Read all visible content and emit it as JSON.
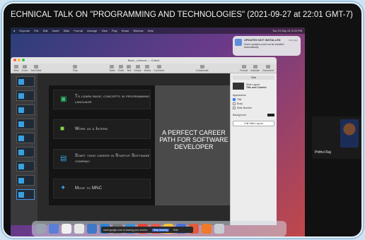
{
  "meeting": {
    "title": "ECHNICAL TALK ON \"PROGRAMMING AND TECHNOLOGIES\" (2021-09-27 at 22:01 GMT-7)"
  },
  "menubar": {
    "items": [
      "Keynote",
      "File",
      "Edit",
      "Insert",
      "Slide",
      "Format",
      "Arrange",
      "View",
      "Play",
      "Share",
      "Window",
      "Help"
    ],
    "right": [
      "Tue 21 Sep 21 9:22 PM"
    ]
  },
  "notification": {
    "title": "UPDATES NOT INSTALLED",
    "time": "now ago",
    "body": "Some updates could not be installed automatically."
  },
  "keynote": {
    "window_title": "Basic_Letdown — Edited",
    "toolbar": [
      "View",
      "Zoom",
      "Add Slide",
      "Play",
      "Table",
      "Chart",
      "Text",
      "Shape",
      "Media",
      "Comment",
      "Collaborate",
      "Format",
      "Animate",
      "Document"
    ],
    "slide": {
      "items": [
        {
          "icon": "terminal-icon",
          "text": "To learn basic concepts in programming language"
        },
        {
          "icon": "briefcase-icon",
          "text": "Work as a Intern"
        },
        {
          "icon": "building-icon",
          "text": "Start your career in Startup Software company"
        },
        {
          "icon": "handshake-icon",
          "text": "Move to MNC"
        }
      ],
      "headline": "A PERFECT CAREER PATH FOR SOFTWARE DEVELOPER"
    },
    "inspector": {
      "header": "Slide",
      "layout_label": "Slide Layout",
      "layout_value": "Title and Content",
      "appearance": "Appearance",
      "checks": [
        {
          "label": "Title",
          "on": true
        },
        {
          "label": "Body",
          "on": false
        },
        {
          "label": "Slide Number",
          "on": false
        }
      ],
      "background": "Background",
      "edit_button": "Edit Slide Layout"
    }
  },
  "share_bar": {
    "message": "meet.google.com is sharing your screen.",
    "stop": "Stop sharing",
    "hide": "Hide"
  },
  "participant": {
    "name": "Prithvi Raj"
  }
}
